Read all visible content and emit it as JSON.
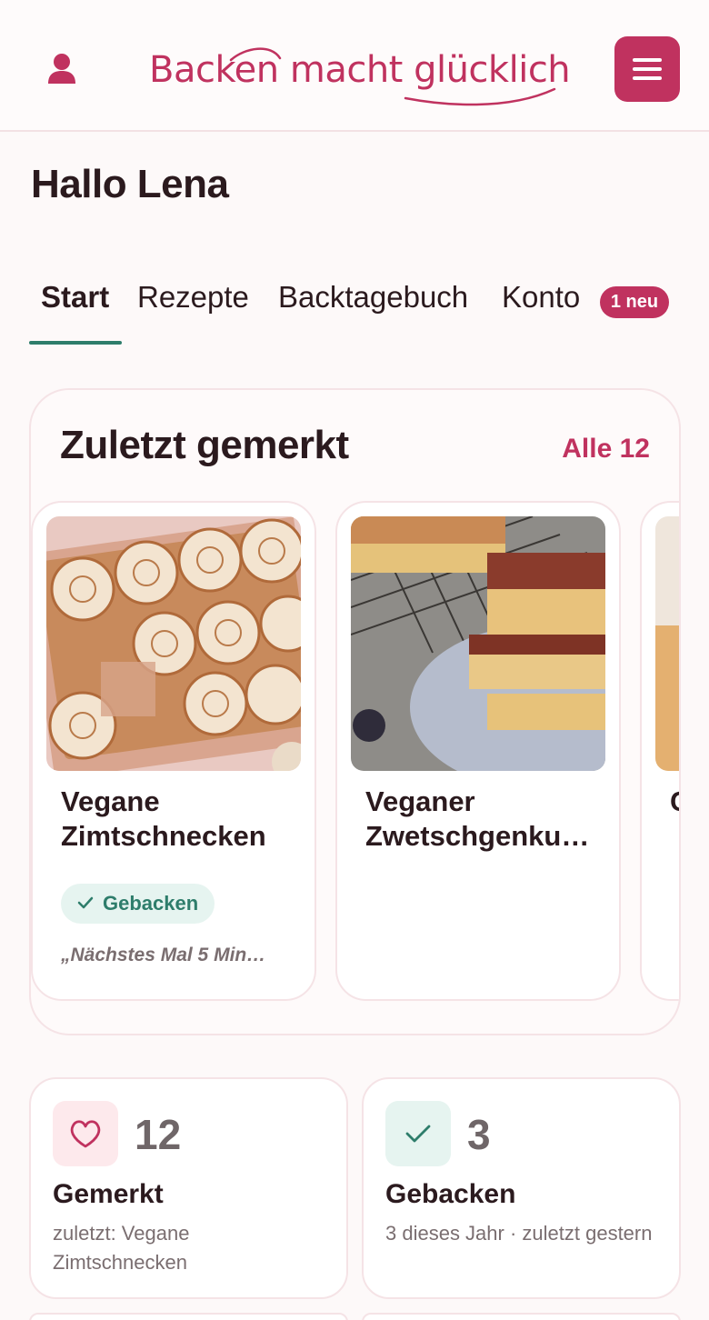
{
  "header": {
    "logo_text": "Backen macht glücklich"
  },
  "greeting": "Hallo Lena",
  "tabs": [
    {
      "label": "Start",
      "active": true
    },
    {
      "label": "Rezepte",
      "active": false
    },
    {
      "label": "Backtagebuch",
      "active": false
    },
    {
      "label": "Konto",
      "active": false
    }
  ],
  "account_badge": "1 neu",
  "saved": {
    "title": "Zuletzt gemerkt",
    "all_link": "Alle 12",
    "recipes": [
      {
        "title": "Vegane Zimtschnecken",
        "status": "Gebacken",
        "note": "„Nächstes Mal 5 Min…"
      },
      {
        "title": "Veganer Zwetschgenku…"
      },
      {
        "title": "C A"
      }
    ]
  },
  "stats": [
    {
      "icon": "heart-icon",
      "value": "12",
      "label": "Gemerkt",
      "sub": "zuletzt: Vegane Zimtschnecken"
    },
    {
      "icon": "check-icon",
      "value": "3",
      "label": "Gebacken",
      "sub": "3 dieses Jahr · zuletzt gestern"
    }
  ],
  "colors": {
    "brand": "#c0325f",
    "accent_green": "#2e7d6b",
    "background": "#fdf9f9"
  }
}
